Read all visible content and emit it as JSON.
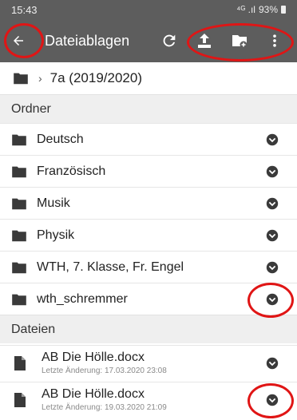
{
  "status_bar": {
    "time": "15:43",
    "signal": "⁴ᴳ .ıl",
    "battery": "93%"
  },
  "app_bar": {
    "back_icon": "arrow-left-icon",
    "title": "Dateiablagen",
    "actions": [
      "refresh-icon",
      "upload-icon",
      "new-folder-icon",
      "more-vert-icon"
    ]
  },
  "breadcrumb": {
    "folder_icon": "folder-icon",
    "current": "7a (2019/2020)"
  },
  "sections": {
    "folders": "Ordner",
    "files": "Dateien"
  },
  "folders": [
    {
      "label": "Deutsch"
    },
    {
      "label": "Französisch"
    },
    {
      "label": "Musik"
    },
    {
      "label": "Physik"
    },
    {
      "label": "WTH, 7. Klasse, Fr. Engel"
    },
    {
      "label": "wth_schremmer"
    }
  ],
  "files": [
    {
      "name": "AB Die Hölle.docx",
      "meta": "Letzte Änderung: 17.03.2020 23:08"
    },
    {
      "name": "AB Die Hölle.docx",
      "meta": "Letzte Änderung: 19.03.2020 21:09"
    }
  ],
  "colors": {
    "app_bar": "#5d5d5d",
    "annotation": "#e01515",
    "icon": "#3a3a3a"
  }
}
